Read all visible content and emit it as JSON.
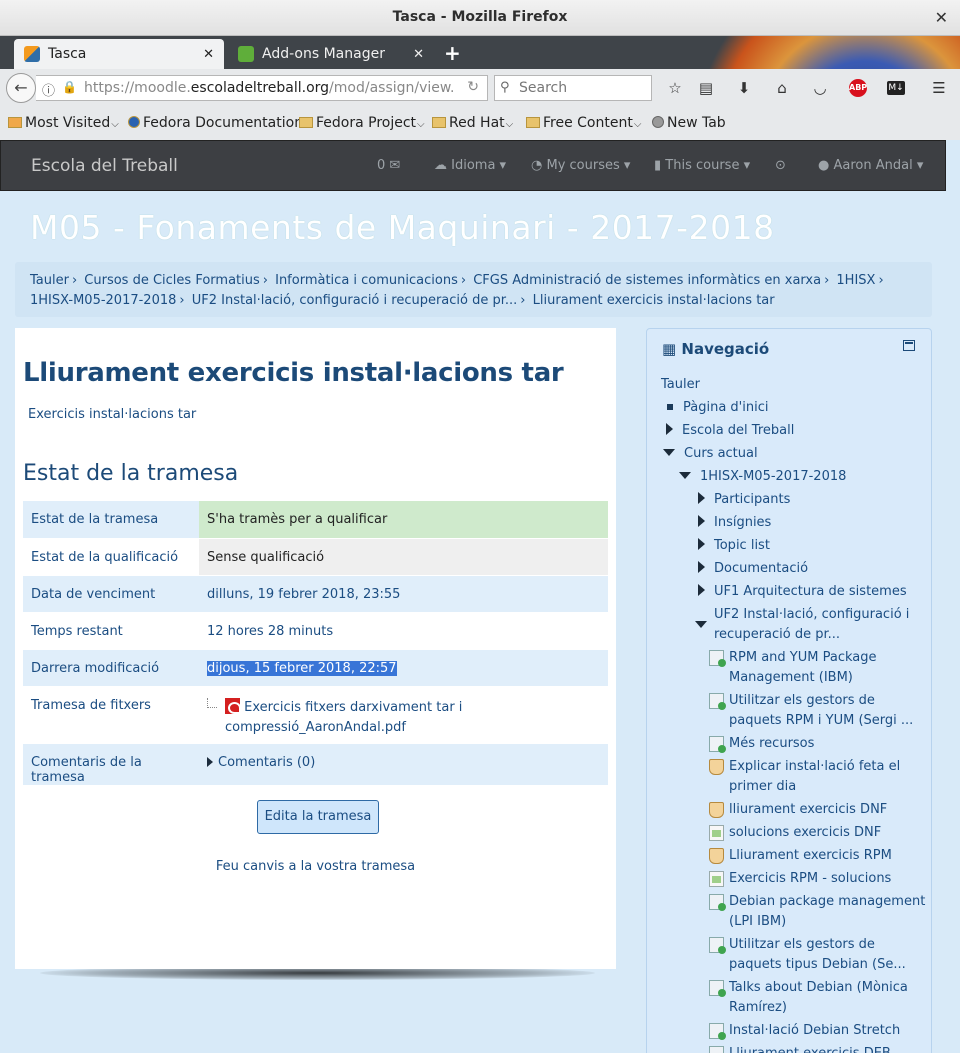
{
  "window": {
    "title": "Tasca - Mozilla Firefox",
    "close": "✕"
  },
  "tabs": [
    {
      "label": "Tasca",
      "close": "✕",
      "active": true
    },
    {
      "label": "Add-ons Manager",
      "close": "✕",
      "active": false
    }
  ],
  "newtab": "+",
  "urlbar": {
    "prefix": "https://moodle.",
    "domain": "escoladeltreball.org",
    "path": "/mod/assign/view."
  },
  "search": {
    "placeholder": "Search"
  },
  "bookmarks": [
    {
      "label": "Most Visited"
    },
    {
      "label": "Fedora Documentation"
    },
    {
      "label": "Fedora Project"
    },
    {
      "label": "Red Hat"
    },
    {
      "label": "Free Content"
    },
    {
      "label": "New Tab"
    }
  ],
  "moodle_nav": {
    "brand": "Escola del Treball",
    "messages": "0 ✉",
    "language": "Idioma",
    "my_courses": "My courses",
    "this_course": "This course",
    "user": "Aaron Andal"
  },
  "page": {
    "heading": "M05 - Fonaments de Maquinari - 2017-2018",
    "breadcrumb": [
      "Tauler",
      "Cursos de Cicles Formatius",
      "Informàtica i comunicacions",
      "CFGS Administració de sistemes informàtics en xarxa",
      "1HISX",
      "1HISX-M05-2017-2018",
      "UF2 Instal·lació, configuració i recuperació de pr...",
      "Lliurament exercicis instal·lacions tar"
    ]
  },
  "assignment": {
    "title": "Lliurament exercicis instal·lacions tar",
    "intro": "Exercicis instal·lacions tar",
    "status_heading": "Estat de la tramesa",
    "rows": [
      {
        "label": "Estat de la tramesa",
        "value": "S'ha tramès per a qualificar"
      },
      {
        "label": "Estat de la qualificació",
        "value": "Sense qualificació"
      },
      {
        "label": "Data de venciment",
        "value": "dilluns, 19 febrer 2018, 23:55"
      },
      {
        "label": "Temps restant",
        "value": "12 hores 28 minuts"
      },
      {
        "label": "Darrera modificació",
        "value": "dijous, 15 febrer 2018, 22:57"
      },
      {
        "label": "Tramesa de fitxers",
        "value": "Exercicis fitxers darxivament tar i compressió_AaronAndal.pdf"
      },
      {
        "label": "Comentaris de la tramesa",
        "value": "Comentaris (0)"
      }
    ],
    "edit_button": "Edita la tramesa",
    "change_text": "Feu canvis a la vostra tramesa"
  },
  "navigation": {
    "title": "Navegació",
    "items": [
      "Tauler",
      "Pàgina d'inici",
      "Escola del Treball",
      "Curs actual",
      "1HISX-M05-2017-2018",
      "Participants",
      "Insígnies",
      "Topic list",
      "Documentació",
      "UF1 Arquitectura de sistemes",
      "UF2 Instal·lació, configuració i recuperació de pr...",
      "RPM and YUM Package Management (IBM)",
      "Utilitzar els gestors de paquets RPM i YUM (Sergi ...",
      "Més recursos",
      "Explicar instal·lació feta el primer dia",
      "lliurament exercicis DNF",
      "solucions exercicis DNF",
      "Lliurament exercicis RPM",
      "Exercicis RPM - solucions",
      "Debian package management (LPI IBM)",
      "Utilitzar els gestors de paquets tipus Debian (Se...",
      "Talks about Debian (Mònica Ramírez)",
      "Instal·lació Debian Stretch",
      "Lliurament exercicis DEB"
    ]
  }
}
